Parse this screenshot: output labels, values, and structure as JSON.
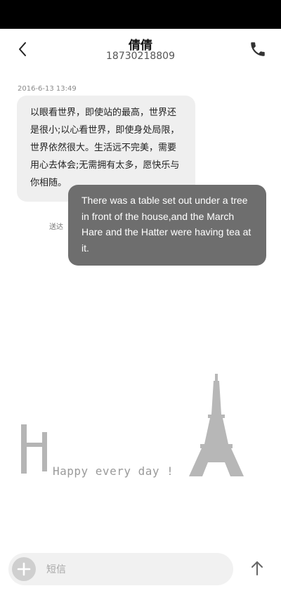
{
  "header": {
    "contact_name": "倩倩",
    "contact_number": "18730218809",
    "back_icon": "chevron-left-icon",
    "call_icon": "phone-icon"
  },
  "conversation": {
    "timestamp": "2016-6-13 13:49",
    "incoming_message": "以眼看世界，即使站的最高，世界还是很小;以心看世界，即使身处局限，世界依然很大。生活远不完美，需要用心去体会;无需拥有太多，愿快乐与你相随。",
    "outgoing_message": "There was a table set out under a tree in front of the house,and the March Hare and the Hatter were having tea at it.",
    "sent_status": "送达"
  },
  "decoration": {
    "text": "Happy every day !",
    "initial_letter": "H",
    "icon": "eiffel-tower-icon"
  },
  "composer": {
    "placeholder": "短信",
    "add_icon": "plus-icon",
    "send_icon": "arrow-up-icon"
  },
  "colors": {
    "incoming_bubble": "#efefef",
    "outgoing_bubble": "#6e6e6e",
    "status_bar": "#000000"
  }
}
